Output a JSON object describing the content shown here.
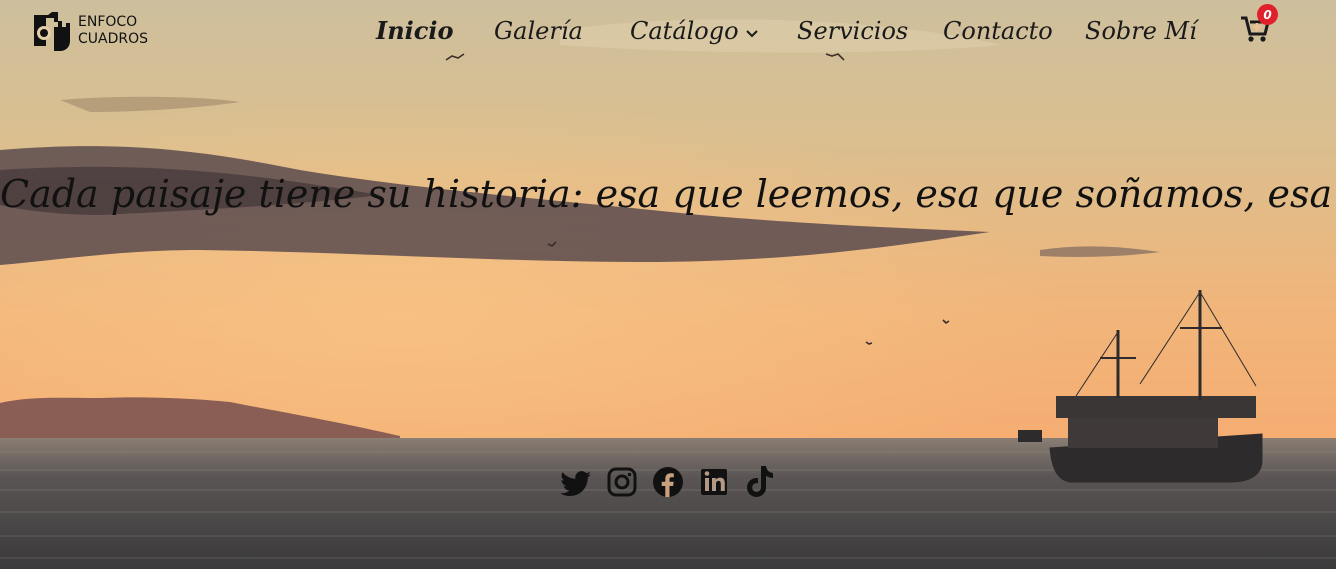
{
  "brand": {
    "line1": "ENFOCO",
    "line2": "CUADROS"
  },
  "nav": {
    "items": [
      {
        "label": "Inicio",
        "active": true
      },
      {
        "label": "Galería",
        "active": false
      },
      {
        "label": "Catálogo",
        "active": false,
        "has_submenu": true
      },
      {
        "label": "Servicios",
        "active": false
      },
      {
        "label": "Contacto",
        "active": false
      },
      {
        "label": "Sobre Mí",
        "active": false
      }
    ]
  },
  "cart": {
    "icon": "cart-plus-icon",
    "count": "0",
    "badge_color": "#e0202a"
  },
  "hero": {
    "tagline": "Cada paisaje tiene su historia: esa que leemos, esa que soñamos, esa que creemos"
  },
  "social": {
    "icons": [
      "twitter-icon",
      "instagram-icon",
      "facebook-icon",
      "linkedin-icon",
      "tiktok-icon"
    ]
  },
  "colors": {
    "sky_top": "#d9c9a3",
    "sky_glow": "#f3b773",
    "sea": "#4d4a4a",
    "text": "#111111"
  }
}
